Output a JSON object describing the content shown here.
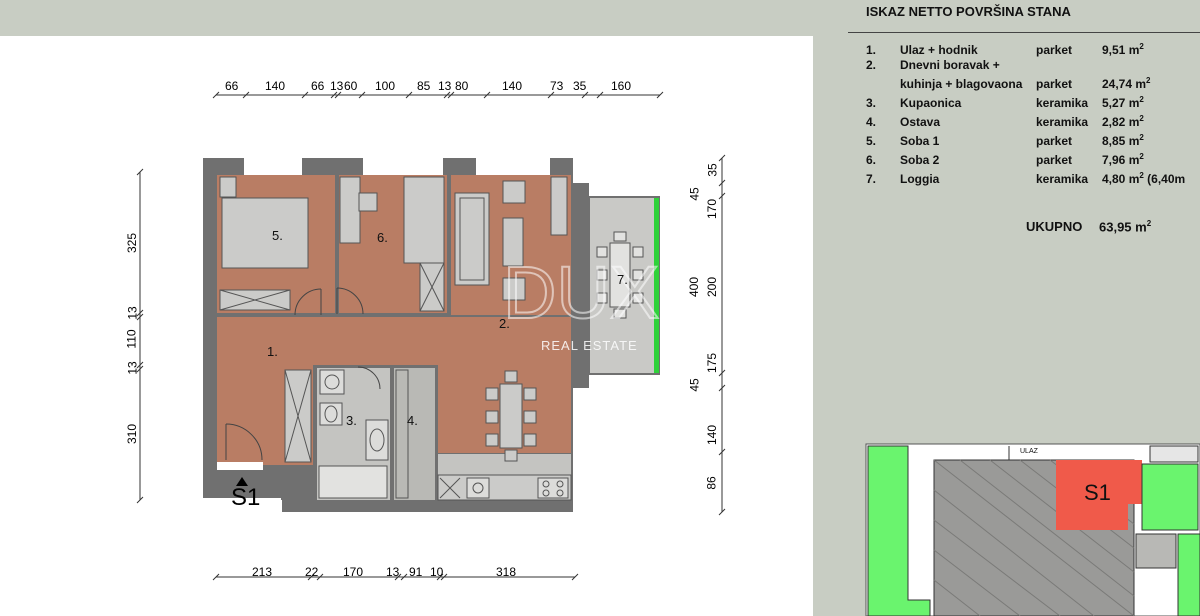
{
  "table": {
    "title": "ISKAZ NETTO POVRŠINA STANA",
    "rows": [
      {
        "no": "1.",
        "name": "Ulaz + hodnik",
        "material": "parket",
        "area": "9,51  m",
        "sup": "2",
        "extra": ""
      },
      {
        "no": "2.",
        "name": "Dnevni boravak +",
        "material": "",
        "area": "",
        "sup": "",
        "extra": ""
      },
      {
        "no": "",
        "name": "kuhinja + blagovaona",
        "material": "parket",
        "area": "24,74 m",
        "sup": "2",
        "extra": ""
      },
      {
        "no": "3.",
        "name": "Kupaonica",
        "material": "keramika",
        "area": "5,27 m",
        "sup": "2",
        "extra": ""
      },
      {
        "no": "4.",
        "name": "Ostava",
        "material": "keramika",
        "area": "2,82 m",
        "sup": "2",
        "extra": ""
      },
      {
        "no": "5.",
        "name": "Soba 1",
        "material": "parket",
        "area": "8,85 m",
        "sup": "2",
        "extra": ""
      },
      {
        "no": "6.",
        "name": "Soba 2",
        "material": "parket",
        "area": "7,96 m",
        "sup": "2",
        "extra": ""
      },
      {
        "no": "7.",
        "name": "Loggia",
        "material": "keramika",
        "area": "4,80 m",
        "sup": "2",
        "extra": " (6,40m"
      }
    ],
    "total_label": "UKUPNO",
    "total_value": "63,95 m",
    "total_sup": "2"
  },
  "plan": {
    "rooms": [
      "1.",
      "2.",
      "3.",
      "4.",
      "5.",
      "6.",
      "7."
    ],
    "section_label": "S1",
    "top_dims": [
      "66",
      "140",
      "66",
      "13",
      "60",
      "100",
      "85",
      "13",
      "80",
      "140",
      "73",
      "35",
      "160"
    ],
    "bottom_dims": [
      "213",
      "22",
      "170",
      "13",
      "91",
      "10",
      "318"
    ],
    "left_dims": [
      "325",
      "13",
      "110",
      "13",
      "310"
    ],
    "right_dims": [
      "35",
      "45",
      "170",
      "400",
      "200",
      "175",
      "45",
      "140",
      "86"
    ]
  },
  "watermark": {
    "logo": "DUX",
    "text": "REAL ESTATE"
  },
  "key_plan": {
    "unit_label": "S1",
    "road_label": "ULAZ"
  },
  "colors": {
    "parquet": "#b97d64",
    "tile": "#c2c2bf",
    "wall": "#6e6e6e",
    "green": "#66f26a",
    "unit": "#f05a4a",
    "background": "#c8cdc3"
  }
}
